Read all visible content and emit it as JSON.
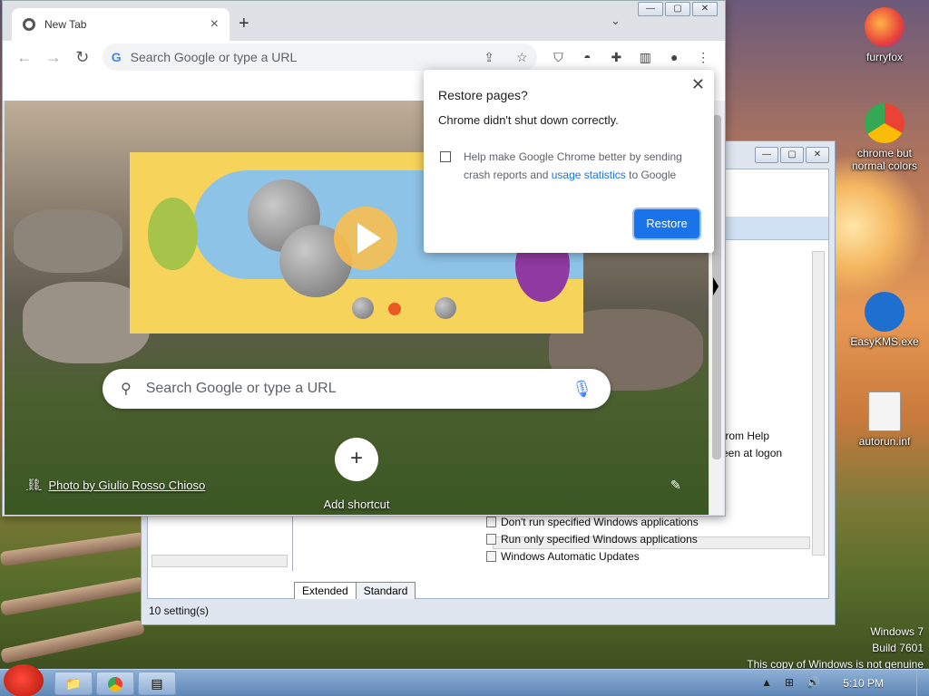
{
  "desktop": {
    "icons": [
      {
        "label": "furryfox",
        "icon": "firefox-icon"
      },
      {
        "label": "chrome but normal colors",
        "icon": "chrome-icon"
      },
      {
        "label": "EasyKMS.exe",
        "icon": "easykms-icon"
      },
      {
        "label": "autorun.inf",
        "icon": "inf-file-icon"
      }
    ],
    "watermark": [
      "Windows 7",
      "Build 7601",
      "This copy of Windows is not genuine"
    ]
  },
  "gpedit": {
    "partial_lines": [
      "from Help",
      "een at logon"
    ],
    "rows": [
      "Don't run specified Windows applications",
      "Run only specified Windows applications",
      "Windows Automatic Updates"
    ],
    "tabs": [
      "Extended",
      "Standard"
    ],
    "status": "10 setting(s)"
  },
  "chrome": {
    "tab_title": "New Tab",
    "omnibox_placeholder": "Search Google or type a URL",
    "ntp_search_placeholder": "Search Google or type a URL",
    "add_shortcut_label": "Add shortcut",
    "photo_credit": "Photo by Giulio Rosso Chioso"
  },
  "restore_dialog": {
    "title": "Restore pages?",
    "message": "Chrome didn't shut down correctly.",
    "help_prefix": "Help make Google Chrome better by sending crash reports and",
    "help_link": "usage statistics",
    "help_suffix": "to Google",
    "button": "Restore"
  },
  "taskbar": {
    "clock": "5:10 PM"
  },
  "colors": {
    "accent": "#1a73e8",
    "taskbar": "#6f93c2"
  }
}
